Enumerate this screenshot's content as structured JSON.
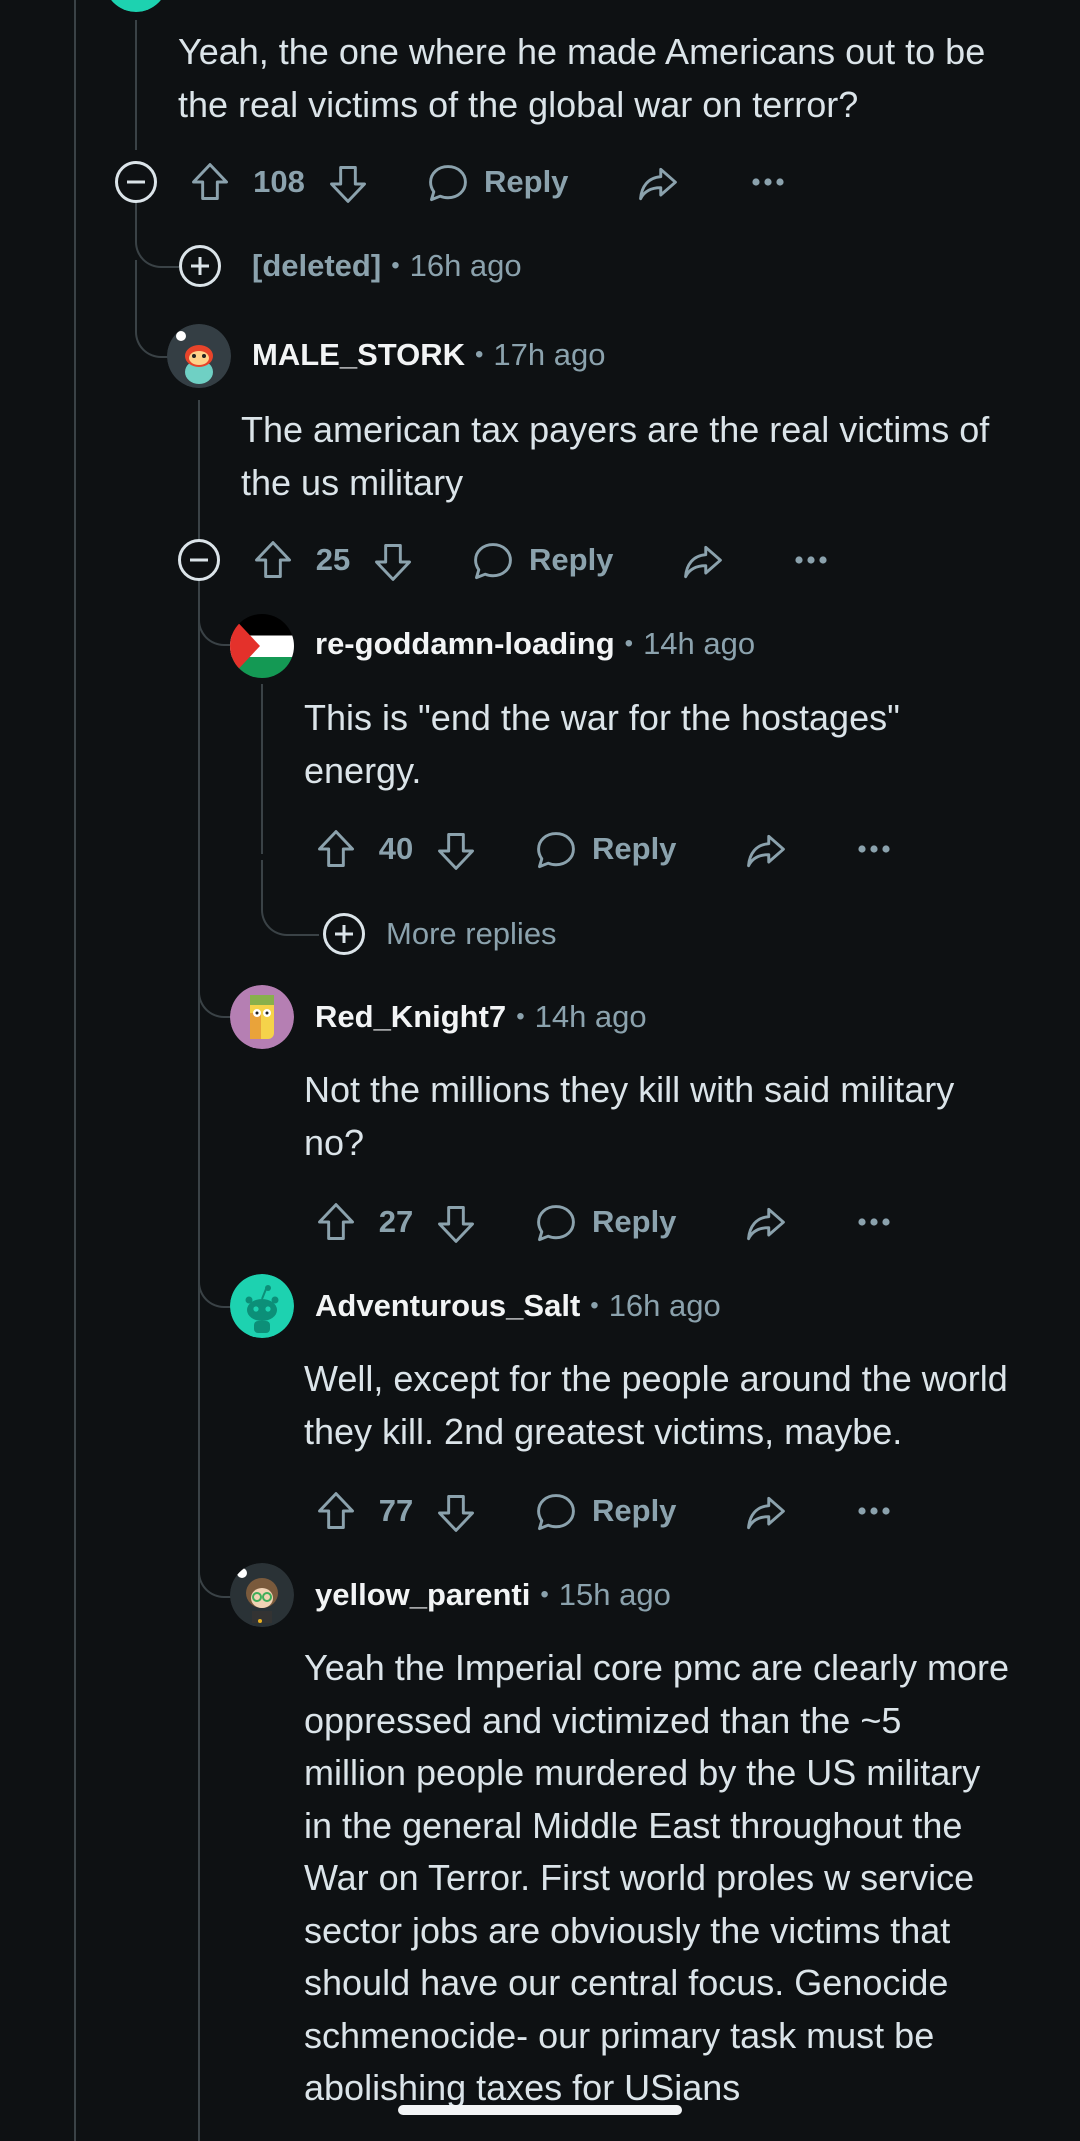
{
  "thread": {
    "top_comment": {
      "body": "Yeah, the one where he made Americans out to be\nthe real victims of the global war on terror?",
      "votes": "108",
      "reply_label": "Reply"
    },
    "deleted_comment": {
      "author": "[deleted]",
      "time": "16h ago"
    },
    "male_stork": {
      "author": "MALE_STORK",
      "time": "17h ago",
      "body": "The american tax payers are the real victims of\nthe us military",
      "votes": "25",
      "reply_label": "Reply"
    },
    "re_goddamn": {
      "author": "re-goddamn-loading",
      "time": "14h ago",
      "body": "This is \"end the war for the hostages\"\nenergy.",
      "votes": "40",
      "reply_label": "Reply",
      "more_replies": "More replies"
    },
    "red_knight": {
      "author": "Red_Knight7",
      "time": "14h ago",
      "body": "Not the millions they kill with said military\nno?",
      "votes": "27",
      "reply_label": "Reply"
    },
    "adventurous_salt": {
      "author": "Adventurous_Salt",
      "time": "16h ago",
      "body": "Well, except for the people around the world\nthey kill. 2nd greatest victims, maybe.",
      "votes": "77",
      "reply_label": "Reply"
    },
    "yellow_parenti": {
      "author": "yellow_parenti",
      "time": "15h ago",
      "body": "Yeah the Imperial core pmc are clearly more\noppressed and victimized than the ~5\nmillion people murdered by the US military\nin the general Middle East throughout the\nWar on Terror. First world proles w service\nsector jobs are obviously the victims that\nshould have our central focus. Genocide\nschmenocide- our primary task must be\nabolishing taxes for USians"
    }
  },
  "icons": {
    "upvote": "arrow-up-icon",
    "downvote": "arrow-down-icon",
    "reply": "speech-bubble-icon",
    "share": "share-arrow-icon",
    "more": "ellipsis-icon",
    "collapse": "minus-circle-icon",
    "expand": "plus-circle-icon"
  },
  "colors": {
    "background": "#0e1113",
    "text": "#dbe4e9",
    "username": "#f2f4f5",
    "meta": "#8ba2ad",
    "thread_line": "#3a4246",
    "snoo_teal": "#1dd2b0"
  }
}
